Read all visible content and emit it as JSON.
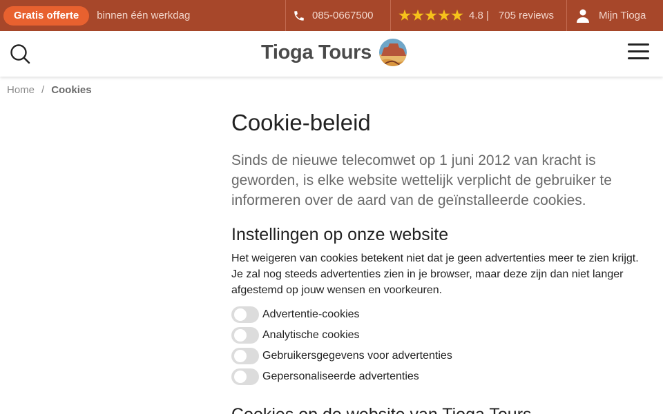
{
  "topbar": {
    "offer_button": "Gratis offerte",
    "offer_sub": "binnen één werkdag",
    "phone": "085-0667500",
    "rating": "4.8 |",
    "reviews": "705 reviews",
    "account": "Mijn Tioga",
    "stars": 5
  },
  "header": {
    "logo_text": "Tioga Tours"
  },
  "breadcrumb": {
    "home": "Home",
    "separator": "/",
    "current": "Cookies"
  },
  "main": {
    "title": "Cookie-beleid",
    "intro": "Sinds de nieuwe telecomwet op 1 juni 2012 van kracht is geworden, is elke website wettelijk verplicht de gebruiker te informeren over de aard van de geïnstalleerde cookies.",
    "settings_heading": "Instellingen op onze website",
    "settings_text": "Het weigeren van cookies betekent niet dat je geen advertenties meer te zien krijgt. Je zal nog steeds advertenties zien in je browser, maar deze zijn dan niet langer afgestemd op jouw wensen en voorkeuren.",
    "toggles": [
      {
        "label": "Advertentie-cookies",
        "on": false
      },
      {
        "label": "Analytische cookies",
        "on": false
      },
      {
        "label": "Gebruikersgegevens voor advertenties",
        "on": false
      },
      {
        "label": "Gepersonaliseerde advertenties",
        "on": false
      }
    ],
    "section_heading": "Cookies op de website van Tioga Tours"
  },
  "colors": {
    "topbar_bg": "#a7472a",
    "offer_button": "#e8612f",
    "star": "#f6c21b",
    "toggle_off": "#dcdcdc"
  }
}
